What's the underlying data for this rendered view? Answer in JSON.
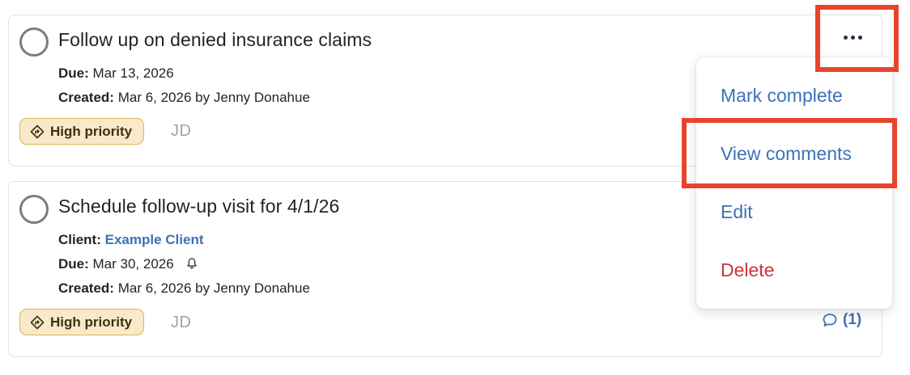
{
  "tasks": [
    {
      "title": "Follow up on denied insurance claims",
      "due_label": "Due:",
      "due_value": "Mar 13, 2026",
      "created_label": "Created:",
      "created_value": "Mar 6, 2026 by Jenny Donahue",
      "priority": "High priority",
      "assignee_initials": "JD"
    },
    {
      "title": "Schedule follow-up visit for 4/1/26",
      "client_label": "Client:",
      "client_value": "Example Client",
      "due_label": "Due:",
      "due_value": "Mar 30, 2026",
      "created_label": "Created:",
      "created_value": "Mar 6, 2026 by Jenny Donahue",
      "priority": "High priority",
      "assignee_initials": "JD",
      "comment_count": "(1)"
    }
  ],
  "menu": {
    "items": [
      {
        "label": "Mark complete"
      },
      {
        "label": "View comments"
      },
      {
        "label": "Edit"
      },
      {
        "label": "Delete"
      }
    ]
  },
  "colors": {
    "accent": "#3d72b8",
    "danger": "#c73539",
    "highlight": "#e8442b",
    "priority_bg": "#fae9c8",
    "priority_border": "#d9b25a"
  },
  "icons": {
    "more": "ellipsis-horizontal-icon",
    "priority": "diamond-arrow-icon",
    "bell": "bell-icon",
    "comment": "comment-bubble-icon"
  }
}
